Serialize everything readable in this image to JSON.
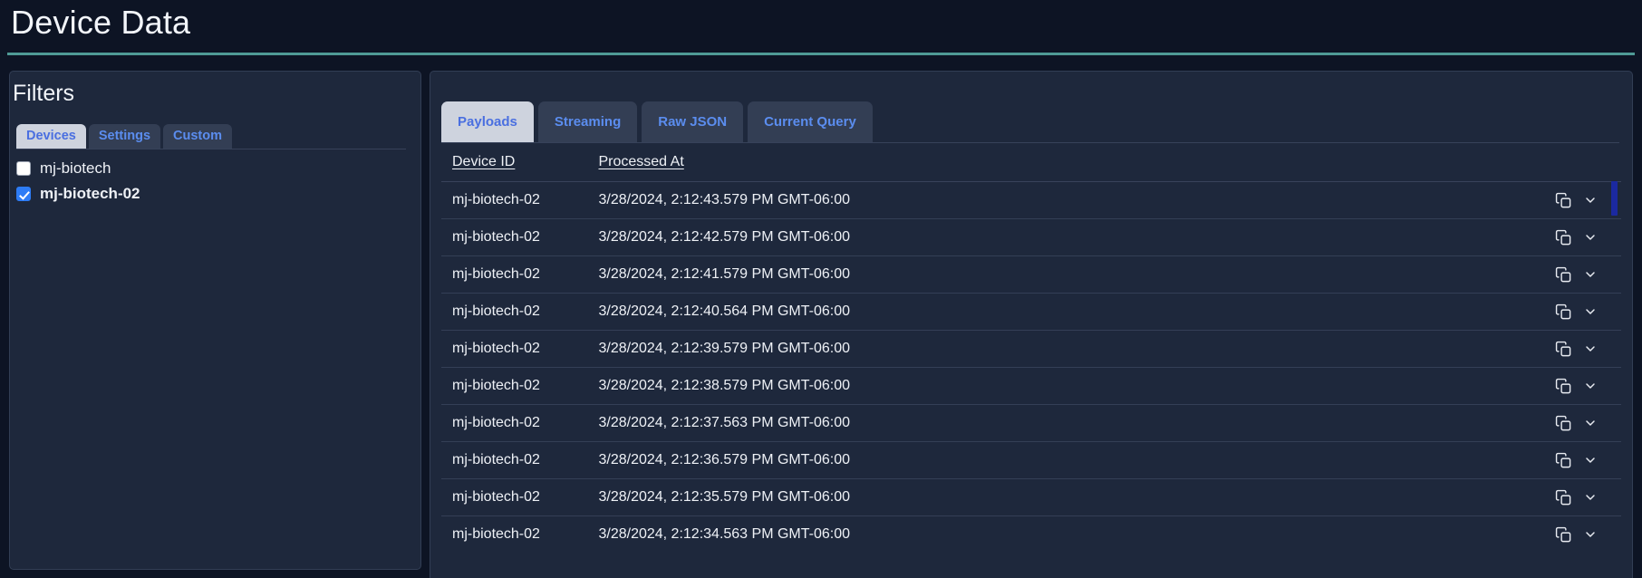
{
  "header": {
    "title": "Device Data",
    "accent_color": "#4f9a96"
  },
  "filters": {
    "heading": "Filters",
    "tabs": [
      {
        "label": "Devices",
        "active": true
      },
      {
        "label": "Settings",
        "active": false
      },
      {
        "label": "Custom",
        "active": false
      }
    ],
    "devices": [
      {
        "label": "mj-biotech",
        "checked": false
      },
      {
        "label": "mj-biotech-02",
        "checked": true
      }
    ]
  },
  "data_panel": {
    "tabs": [
      {
        "label": "Payloads",
        "active": true
      },
      {
        "label": "Streaming",
        "active": false
      },
      {
        "label": "Raw JSON",
        "active": false
      },
      {
        "label": "Current Query",
        "active": false
      }
    ],
    "table": {
      "columns": [
        "Device ID",
        "Processed At"
      ],
      "row_icons": [
        "copy-icon",
        "chevron-down-icon"
      ],
      "rows": [
        {
          "device_id": "mj-biotech-02",
          "processed_at": "3/28/2024, 2:12:43.579 PM GMT-06:00"
        },
        {
          "device_id": "mj-biotech-02",
          "processed_at": "3/28/2024, 2:12:42.579 PM GMT-06:00"
        },
        {
          "device_id": "mj-biotech-02",
          "processed_at": "3/28/2024, 2:12:41.579 PM GMT-06:00"
        },
        {
          "device_id": "mj-biotech-02",
          "processed_at": "3/28/2024, 2:12:40.564 PM GMT-06:00"
        },
        {
          "device_id": "mj-biotech-02",
          "processed_at": "3/28/2024, 2:12:39.579 PM GMT-06:00"
        },
        {
          "device_id": "mj-biotech-02",
          "processed_at": "3/28/2024, 2:12:38.579 PM GMT-06:00"
        },
        {
          "device_id": "mj-biotech-02",
          "processed_at": "3/28/2024, 2:12:37.563 PM GMT-06:00"
        },
        {
          "device_id": "mj-biotech-02",
          "processed_at": "3/28/2024, 2:12:36.579 PM GMT-06:00"
        },
        {
          "device_id": "mj-biotech-02",
          "processed_at": "3/28/2024, 2:12:35.579 PM GMT-06:00"
        },
        {
          "device_id": "mj-biotech-02",
          "processed_at": "3/28/2024, 2:12:34.563 PM GMT-06:00"
        }
      ]
    },
    "scrollbar": {
      "thumb_color": "#1b29a0"
    }
  }
}
